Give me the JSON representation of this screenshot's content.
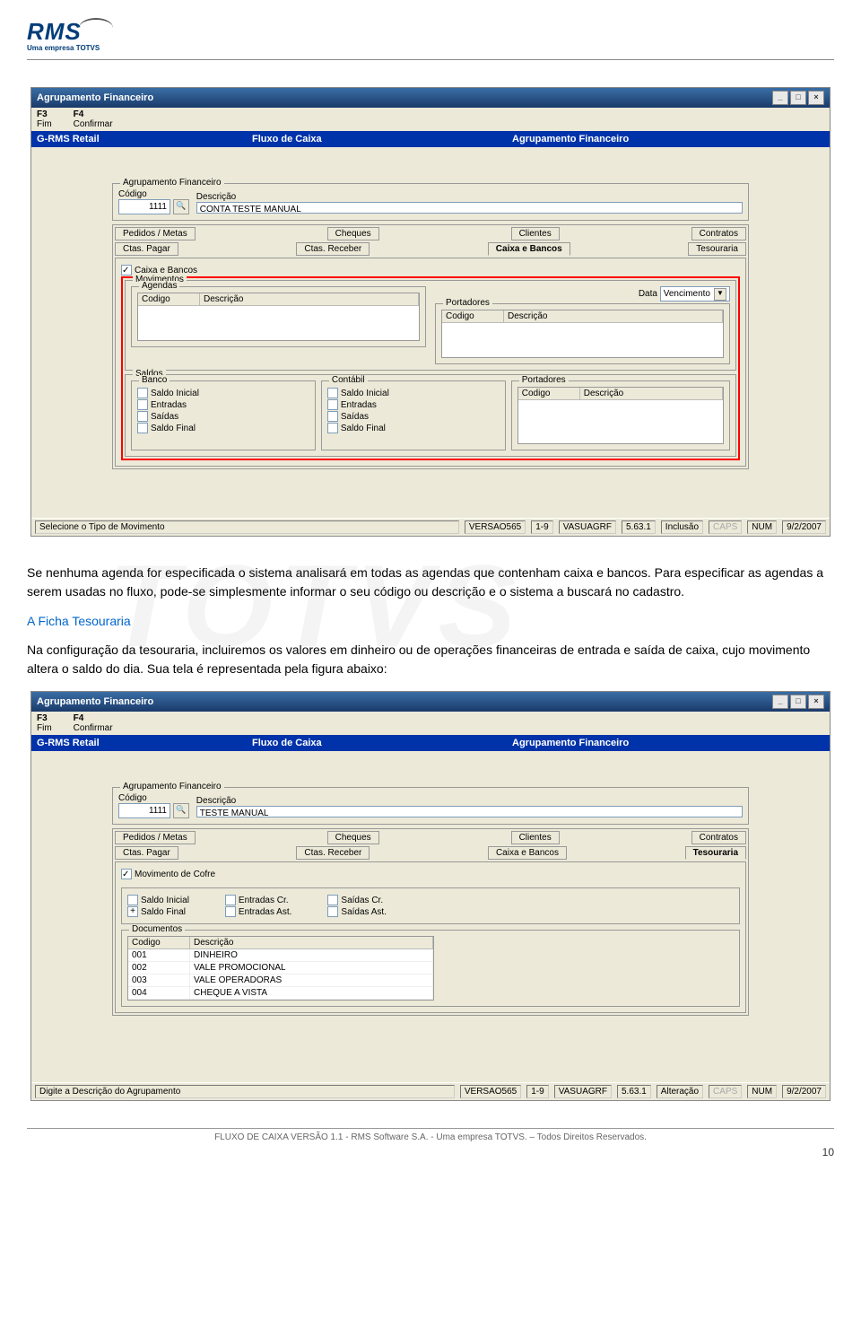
{
  "logo": {
    "brand": "RMS",
    "tagline": "Uma empresa TOTVS"
  },
  "screenshot1": {
    "title": "Agrupamento Financeiro",
    "menu": {
      "f3": "F3",
      "f3label": "Fim",
      "f4": "F4",
      "f4label": "Confirmar"
    },
    "bluebar": {
      "left": "G-RMS Retail",
      "mid": "Fluxo de Caixa",
      "right": "Agrupamento Financeiro"
    },
    "agrup": {
      "legend": "Agrupamento Financeiro",
      "codLabel": "Código",
      "descLabel": "Descrição",
      "cod": "1111",
      "desc": "CONTA TESTE MANUAL"
    },
    "tabsTop": [
      "Pedidos / Metas",
      "Cheques",
      "Clientes",
      "Contratos"
    ],
    "tabsBottom": [
      "Ctas. Pagar",
      "Ctas. Receber",
      "Caixa e Bancos",
      "Tesouraria"
    ],
    "cbLabel": "Caixa e Bancos",
    "movLegend": "Movimentos",
    "agLegend": "Agendas",
    "portLegend": "Portadores",
    "dataLabel": "Data",
    "dataValue": "Vencimento",
    "colCodigo": "Codigo",
    "colDescricao": "Descrição",
    "saldosLegend": "Saldos",
    "bancoLegend": "Banco",
    "contabilLegend": "Contábil",
    "port2Legend": "Portadores",
    "saldoItems": [
      "Saldo Inicial",
      "Entradas",
      "Saídas",
      "Saldo Final"
    ],
    "status": {
      "left": "Selecione o Tipo de Movimento",
      "ver": "VERSAO565",
      "pg": "1-9",
      "user": "VASUAGRF",
      "v": "5.63.1",
      "mode": "Inclusão",
      "caps": "CAPS",
      "num": "NUM",
      "date": "9/2/2007"
    }
  },
  "para1": "Se nenhuma agenda for especificada o sistema analisará em todas as agendas que contenham caixa e bancos. Para especificar as agendas a serem usadas no fluxo, pode-se simplesmente informar o seu código ou descrição e o sistema a buscará no cadastro.",
  "heading": "A Ficha Tesouraria",
  "para2": "Na configuração da tesouraria, incluiremos os valores em dinheiro ou de operações financeiras de entrada e saída de caixa, cujo movimento altera o saldo do dia. Sua tela é representada pela figura abaixo:",
  "screenshot2": {
    "title": "Agrupamento Financeiro",
    "menu": {
      "f3": "F3",
      "f3label": "Fim",
      "f4": "F4",
      "f4label": "Confirmar"
    },
    "bluebar": {
      "left": "G-RMS Retail",
      "mid": "Fluxo de Caixa",
      "right": "Agrupamento Financeiro"
    },
    "agrup": {
      "legend": "Agrupamento Financeiro",
      "codLabel": "Código",
      "descLabel": "Descrição",
      "cod": "1111",
      "desc": "TESTE MANUAL"
    },
    "tabsTop": [
      "Pedidos / Metas",
      "Cheques",
      "Clientes",
      "Contratos"
    ],
    "tabsBottom": [
      "Ctas. Pagar",
      "Ctas. Receber",
      "Caixa e Bancos",
      "Tesouraria"
    ],
    "movCofre": "Movimento de Cofre",
    "saldoInicial": "Saldo Inicial",
    "entradasCr": "Entradas Cr.",
    "saidasCr": "Saídas Cr.",
    "saldoFinal": "Saldo Final",
    "entradasAst": "Entradas Ast.",
    "saidasAst": "Saídas Ast.",
    "docsLegend": "Documentos",
    "docCols": {
      "cod": "Codigo",
      "desc": "Descrição"
    },
    "docs": [
      {
        "cod": "001",
        "desc": "DINHEIRO"
      },
      {
        "cod": "002",
        "desc": "VALE PROMOCIONAL"
      },
      {
        "cod": "003",
        "desc": "VALE OPERADORAS"
      },
      {
        "cod": "004",
        "desc": "CHEQUE A VISTA"
      }
    ],
    "status": {
      "left": "Digite a Descrição do Agrupamento",
      "ver": "VERSAO565",
      "pg": "1-9",
      "user": "VASUAGRF",
      "v": "5.63.1",
      "mode": "Alteração",
      "caps": "CAPS",
      "num": "NUM",
      "date": "9/2/2007"
    }
  },
  "footer": "FLUXO DE CAIXA VERSÃO 1.1 - RMS Software S.A.  - Uma empresa TOTVS. – Todos Direitos Reservados.",
  "pageNum": "10"
}
